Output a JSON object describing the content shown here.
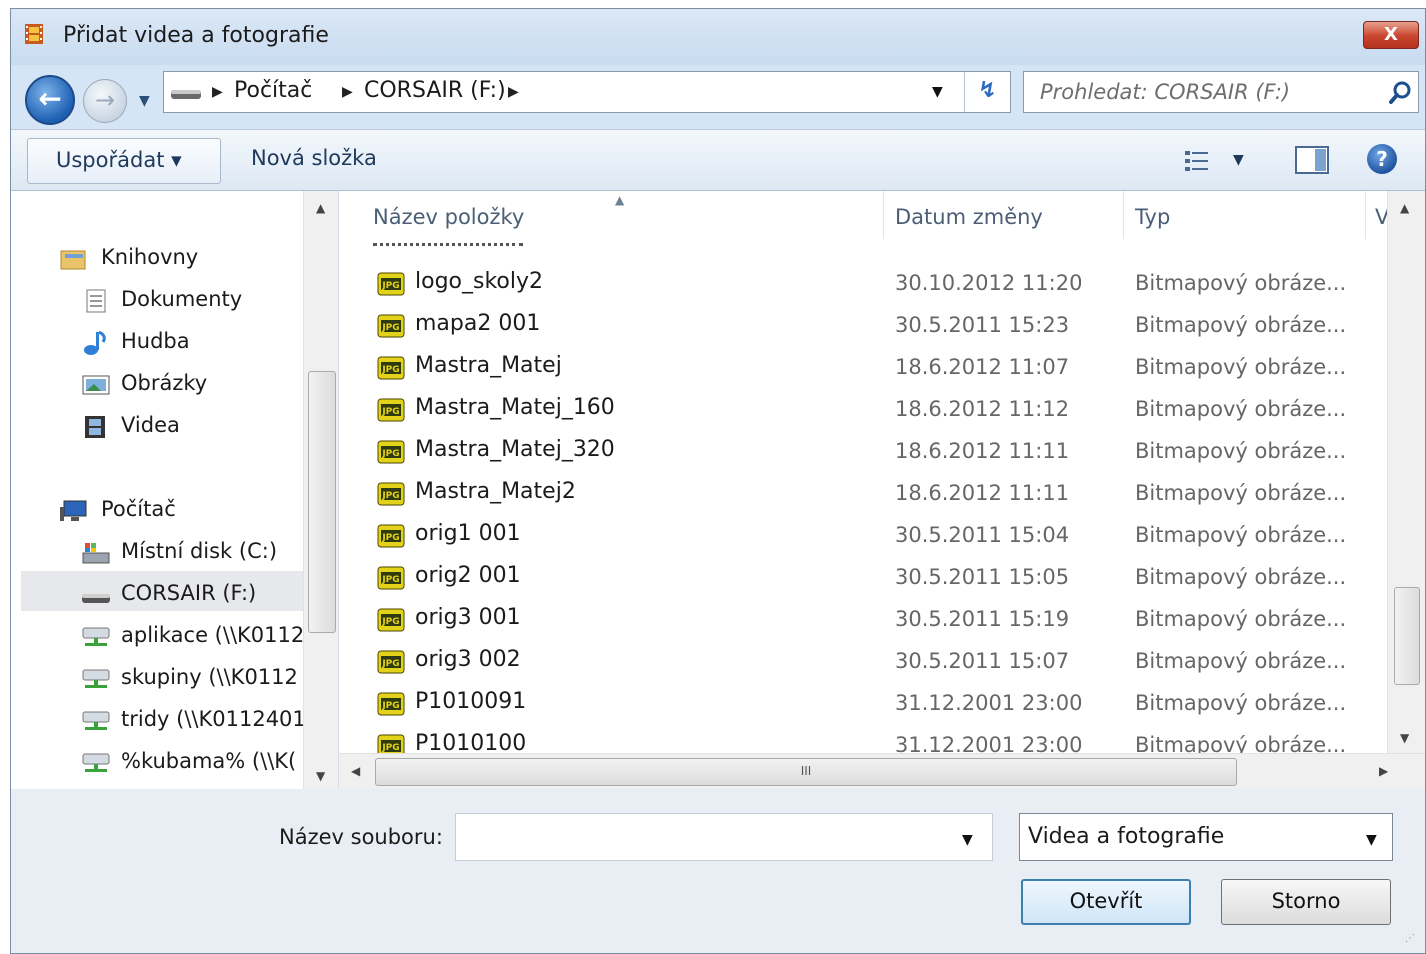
{
  "window": {
    "title": "Přidat videa a fotografie",
    "close_label": "X"
  },
  "nav": {
    "back_icon": "back-arrow-icon",
    "forward_icon": "forward-arrow-icon",
    "breadcrumbs": [
      "Počítač",
      "CORSAIR (F:)"
    ],
    "search_placeholder": "Prohledat: CORSAIR (F:)"
  },
  "toolbar": {
    "organize_label": "Uspořádat ▾",
    "new_folder_label": "Nová složka"
  },
  "sidebar": {
    "items": [
      {
        "label": "Knihovny",
        "icon": "libraries-icon"
      },
      {
        "label": "Dokumenty",
        "icon": "documents-icon"
      },
      {
        "label": "Hudba",
        "icon": "music-icon"
      },
      {
        "label": "Obrázky",
        "icon": "pictures-icon"
      },
      {
        "label": "Videa",
        "icon": "videos-icon"
      },
      {
        "label": "Počítač",
        "icon": "computer-icon"
      },
      {
        "label": "Místní disk (C:)",
        "icon": "local-disk-icon"
      },
      {
        "label": "CORSAIR (F:)",
        "icon": "usb-drive-icon",
        "selected": true
      },
      {
        "label": "aplikace (\\\\K0112",
        "icon": "network-drive-icon"
      },
      {
        "label": "skupiny (\\\\K0112",
        "icon": "network-drive-icon"
      },
      {
        "label": "tridy (\\\\K0112401",
        "icon": "network-drive-icon"
      },
      {
        "label": "%kubama% (\\\\K(",
        "icon": "network-drive-icon"
      }
    ]
  },
  "filelist": {
    "columns": [
      "Název položky",
      "Datum změny",
      "Typ",
      "V"
    ],
    "rows": [
      {
        "name": "logo_skoly2",
        "date": "30.10.2012 11:20",
        "type": "Bitmapový obráze..."
      },
      {
        "name": "mapa2 001",
        "date": "30.5.2011 15:23",
        "type": "Bitmapový obráze..."
      },
      {
        "name": "Mastra_Matej",
        "date": "18.6.2012 11:07",
        "type": "Bitmapový obráze..."
      },
      {
        "name": "Mastra_Matej_160",
        "date": "18.6.2012 11:12",
        "type": "Bitmapový obráze..."
      },
      {
        "name": "Mastra_Matej_320",
        "date": "18.6.2012 11:11",
        "type": "Bitmapový obráze..."
      },
      {
        "name": "Mastra_Matej2",
        "date": "18.6.2012 11:11",
        "type": "Bitmapový obráze..."
      },
      {
        "name": "orig1 001",
        "date": "30.5.2011 15:04",
        "type": "Bitmapový obráze..."
      },
      {
        "name": "orig2 001",
        "date": "30.5.2011 15:05",
        "type": "Bitmapový obráze..."
      },
      {
        "name": "orig3 001",
        "date": "30.5.2011 15:19",
        "type": "Bitmapový obráze..."
      },
      {
        "name": "orig3 002",
        "date": "30.5.2011 15:07",
        "type": "Bitmapový obráze..."
      },
      {
        "name": "P1010091",
        "date": "31.12.2001 23:00",
        "type": "Bitmapový obráze..."
      },
      {
        "name": "P1010100",
        "date": "31.12.2001 23:00",
        "type": "Bitmapový obráze..."
      }
    ],
    "file_icon": "jpg-file-icon",
    "hscroll_grip": "III"
  },
  "bottom": {
    "filename_label": "Název souboru:",
    "filename_value": "",
    "filter_value": "Videa a fotografie",
    "open_label": "Otevřít",
    "cancel_label": "Storno"
  }
}
